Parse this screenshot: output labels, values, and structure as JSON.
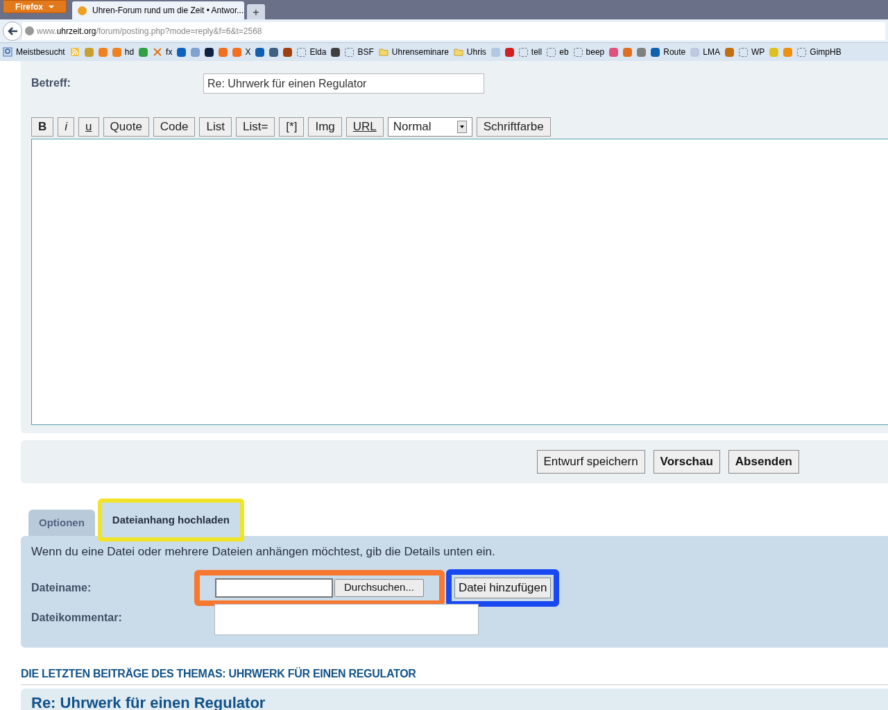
{
  "browser": {
    "menu_button": "Firefox",
    "tabs": [
      {
        "title": "Uhren-Forum rund um die Zeit • Antwor...",
        "selected": true
      }
    ],
    "new_tab": "+",
    "url_host_prefix": "www.",
    "url_host": "uhrzeit.org",
    "url_path": "/forum/posting.php?mode=reply&f=6&t=2568"
  },
  "bookmarks": [
    {
      "kind": "search",
      "label": "Meistbesucht"
    },
    {
      "kind": "feed"
    },
    {
      "kind": "logo",
      "color": "#c8a030"
    },
    {
      "kind": "logo",
      "color": "#f08020"
    },
    {
      "kind": "logo",
      "color": "#f08020",
      "label": "hd"
    },
    {
      "kind": "logo",
      "color": "#30a040"
    },
    {
      "kind": "cross",
      "label": "fx"
    },
    {
      "kind": "logo",
      "color": "#1060c0"
    },
    {
      "kind": "logo",
      "color": "#80a0d0"
    },
    {
      "kind": "logo",
      "color": "#102040"
    },
    {
      "kind": "logo",
      "color": "#f07020"
    },
    {
      "kind": "logo",
      "color": "#f07020",
      "label": "X"
    },
    {
      "kind": "logo",
      "color": "#1060b0"
    },
    {
      "kind": "logo",
      "color": "#406080"
    },
    {
      "kind": "logo",
      "color": "#a04010"
    },
    {
      "kind": "dashed",
      "label": "Elda"
    },
    {
      "kind": "logo",
      "color": "#404040"
    },
    {
      "kind": "dashed",
      "label": "BSF"
    },
    {
      "kind": "folder",
      "label": "Uhrenseminare"
    },
    {
      "kind": "folder",
      "label": "Uhris"
    },
    {
      "kind": "logo",
      "color": "#b0c8e0"
    },
    {
      "kind": "logo",
      "color": "#d02020"
    },
    {
      "kind": "dashed",
      "label": "tell"
    },
    {
      "kind": "dashed",
      "label": "eb"
    },
    {
      "kind": "dashed",
      "label": "beep"
    },
    {
      "kind": "logo",
      "color": "#e05080"
    },
    {
      "kind": "logo",
      "color": "#e07020"
    },
    {
      "kind": "logo",
      "color": "#808080"
    },
    {
      "kind": "logo",
      "color": "#1060b0",
      "label": "Route"
    },
    {
      "kind": "logo",
      "color": "#c0c8e0",
      "label": "LMA"
    },
    {
      "kind": "logo",
      "color": "#c07010"
    },
    {
      "kind": "dashed",
      "label": "WP"
    },
    {
      "kind": "logo",
      "color": "#e0c020"
    },
    {
      "kind": "logo",
      "color": "#f09010"
    },
    {
      "kind": "dashed",
      "label": "GimpHB"
    }
  ],
  "subject": {
    "label": "Betreff:",
    "value": "Re: Uhrwerk für einen Regulator"
  },
  "toolbar": [
    {
      "label": "B",
      "kind": "bold"
    },
    {
      "label": "i",
      "kind": "italic"
    },
    {
      "label": "u",
      "kind": "underline"
    },
    {
      "label": "Quote",
      "kind": "plain"
    },
    {
      "label": "Code",
      "kind": "plain"
    },
    {
      "label": "List",
      "kind": "plain"
    },
    {
      "label": "List=",
      "kind": "plain"
    },
    {
      "label": "[*]",
      "kind": "plain"
    },
    {
      "label": "Img",
      "kind": "plain"
    },
    {
      "label": "URL",
      "kind": "underline"
    },
    {
      "label": "Normal",
      "kind": "select"
    },
    {
      "label": "Schriftfarbe",
      "kind": "plain"
    }
  ],
  "actions": [
    {
      "label": "Entwurf speichern",
      "primary": false
    },
    {
      "label": "Vorschau",
      "primary": true
    },
    {
      "label": "Absenden",
      "primary": true
    }
  ],
  "option_tabs": [
    {
      "label": "Optionen",
      "selected": false
    },
    {
      "label": "Dateianhang hochladen",
      "selected": true
    }
  ],
  "attachment": {
    "intro": "Wenn du eine Datei oder mehrere Dateien anhängen möchtest, gib die Details unten ein.",
    "filename_label": "Dateiname:",
    "browse_button": "Durchsuchen...",
    "add_button": "Datei hinzufügen",
    "comment_label": "Dateikommentar:"
  },
  "annotations": [
    {
      "color": "#f0e428"
    },
    {
      "color": "#f87830"
    },
    {
      "color": "#1848f0"
    }
  ],
  "recent": {
    "heading": "DIE LETZTEN BEITRÄGE DES THEMAS: UHRWERK FÜR EINEN REGULATOR",
    "post_title": "Re: Uhrwerk für einen Regulator"
  }
}
